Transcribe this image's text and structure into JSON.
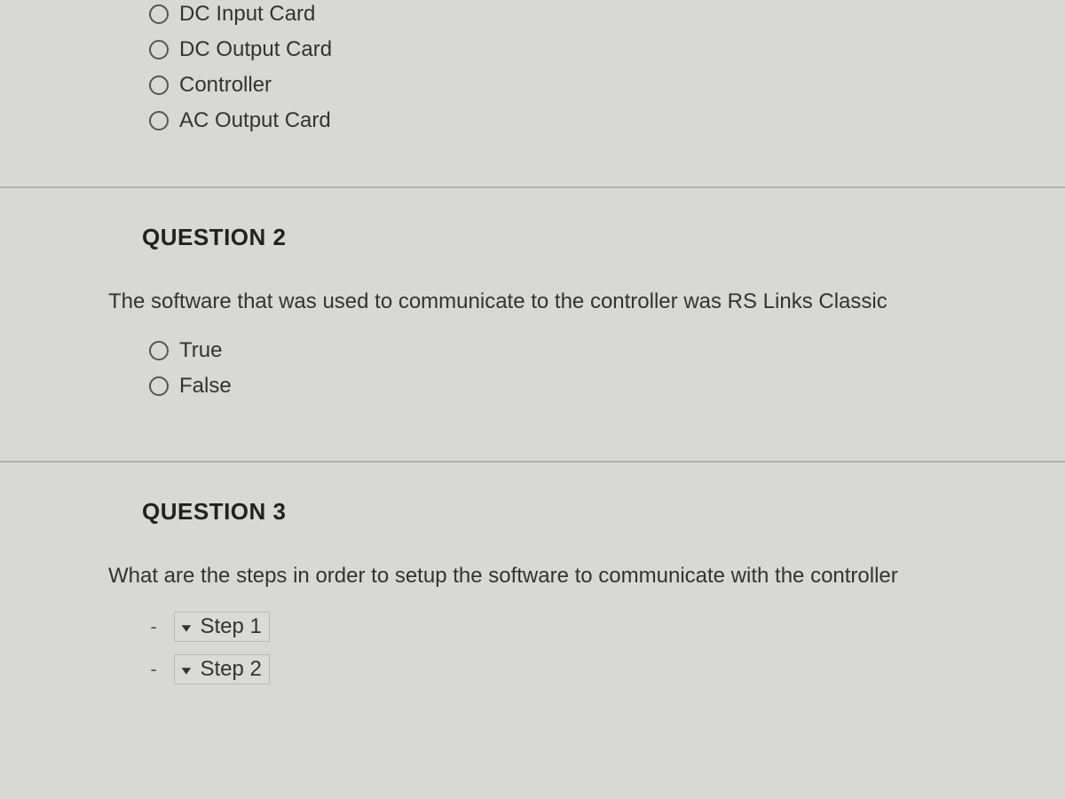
{
  "q1": {
    "options": [
      {
        "label": "DC Input Card"
      },
      {
        "label": "DC Output Card"
      },
      {
        "label": "Controller"
      },
      {
        "label": "AC Output Card"
      }
    ]
  },
  "q2": {
    "header": "QUESTION 2",
    "text": "The software that was used to communicate to the controller was RS Links Classic",
    "options": [
      {
        "label": "True"
      },
      {
        "label": "False"
      }
    ]
  },
  "q3": {
    "header": "QUESTION 3",
    "text": "What are the steps in order to setup the software to communicate with the controller",
    "steps": [
      {
        "label": "Step 1",
        "placeholder": "-"
      },
      {
        "label": "Step 2",
        "placeholder": "-"
      }
    ]
  }
}
